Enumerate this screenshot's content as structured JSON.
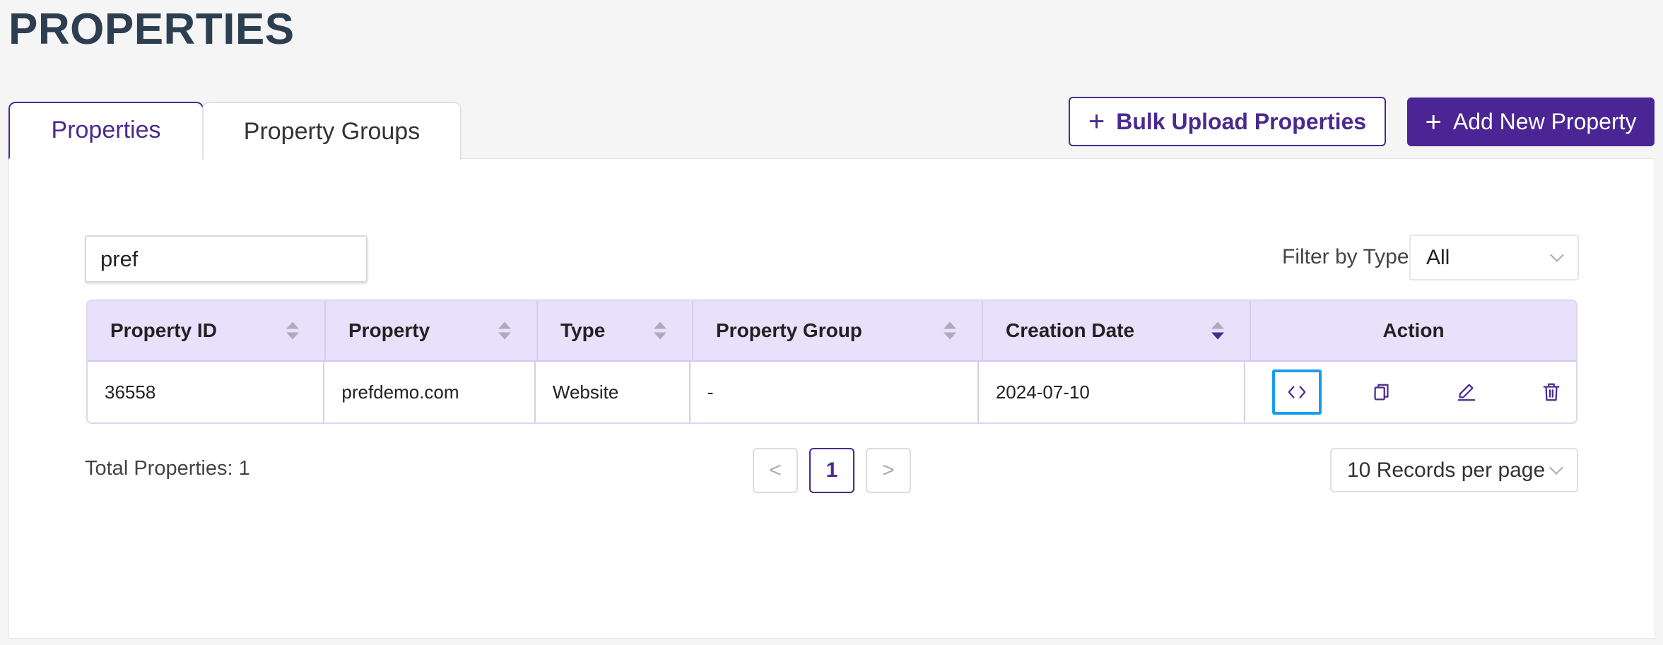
{
  "page": {
    "title": "PROPERTIES"
  },
  "tabs": [
    {
      "label": "Properties",
      "active": true
    },
    {
      "label": "Property Groups",
      "active": false
    }
  ],
  "toolbar": {
    "bulk_upload_label": "Bulk Upload Properties",
    "add_new_label": "Add New Property"
  },
  "search": {
    "value": "pref"
  },
  "filter": {
    "label": "Filter by Type:",
    "selected": "All"
  },
  "table": {
    "columns": [
      "Property ID",
      "Property",
      "Type",
      "Property Group",
      "Creation Date",
      "Action"
    ],
    "sorted_column": "Creation Date",
    "rows": [
      {
        "property_id": "36558",
        "property": "prefdemo.com",
        "type": "Website",
        "property_group": "-",
        "creation_date": "2024-07-10"
      }
    ]
  },
  "footer": {
    "total": "Total Properties: 1",
    "current_page": "1",
    "prev_glyph": "<",
    "next_glyph": ">",
    "records_per_page": "10 Records per page"
  },
  "icons": {
    "embed": "code-icon",
    "copy": "copy-icon",
    "edit": "pencil-icon",
    "delete": "trash-icon"
  },
  "colors": {
    "accent": "#4a2593",
    "highlight": "#1a9cf0",
    "header_bg": "#e9e0fb"
  }
}
